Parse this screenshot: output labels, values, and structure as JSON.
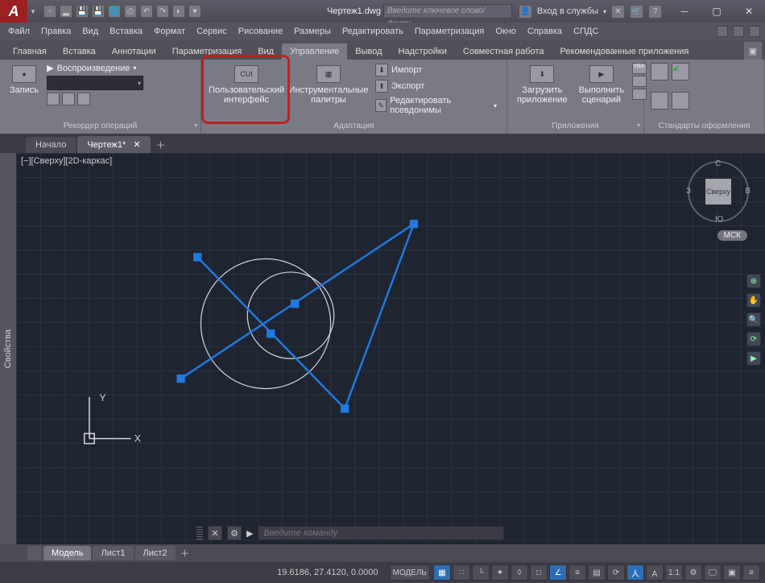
{
  "titlebar": {
    "logo": "A",
    "doc_title": "Чертеж1.dwg",
    "search_placeholder": "Введите ключевое слово/фразу",
    "signin": "Вход в службы"
  },
  "menubar": [
    "Файл",
    "Правка",
    "Вид",
    "Вставка",
    "Формат",
    "Сервис",
    "Рисование",
    "Размеры",
    "Редактировать",
    "Параметризация",
    "Окно",
    "Справка",
    "СПДС"
  ],
  "ribtabs": [
    "Главная",
    "Вставка",
    "Аннотации",
    "Параметризация",
    "Вид",
    "Управление",
    "Вывод",
    "Надстройки",
    "Совместная работа",
    "Рекомендованные приложения"
  ],
  "ribtabs_active_index": 5,
  "ribbon": {
    "record": {
      "play": "Воспроизведение",
      "record": "Запись",
      "panel": "Рекордер операций"
    },
    "adapt": {
      "cui_badge": "CUI",
      "cui": "Пользовательский интерфейс",
      "palettes": "Инструментальные палитры",
      "import": "Импорт",
      "export": "Экспорт",
      "aliases": "Редактировать псевдонимы",
      "panel": "Адаптация"
    },
    "apps": {
      "load": "Загрузить приложение",
      "run": "Выполнить сценарий",
      "panel": "Приложения"
    },
    "stds": {
      "panel": "Стандарты оформления"
    }
  },
  "doctabs": {
    "start": "Начало",
    "drawing": "Чертеж1*"
  },
  "viewport": {
    "label": "[−][Сверху][2D-каркас]",
    "cube": "Сверху",
    "dir_n": "С",
    "dir_s": "Ю",
    "dir_e": "В",
    "dir_w": "З",
    "wcs": "МСК",
    "axis_x": "X",
    "axis_y": "Y"
  },
  "sidepanel": "Свойства",
  "cmdline": {
    "placeholder": "Введите команду",
    "arrow": "▶"
  },
  "laytabs": {
    "model": "Модель",
    "l1": "Лист1",
    "l2": "Лист2"
  },
  "statusbar": {
    "coords": "19.6186, 27.4120, 0.0000",
    "model": "МОДЕЛЬ",
    "scale": "1:1"
  }
}
